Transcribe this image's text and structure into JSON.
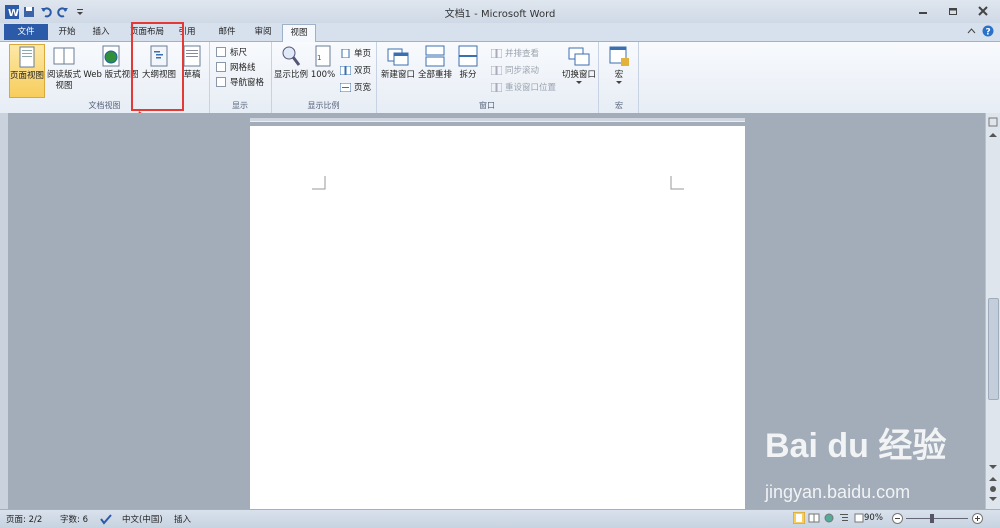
{
  "window": {
    "title": "文档1 - Microsoft Word"
  },
  "tabs": [
    "文件",
    "开始",
    "插入",
    "页面布局",
    "引用",
    "邮件",
    "审阅",
    "视图"
  ],
  "ribbon": {
    "doc_views": {
      "group_label": "文档视图",
      "print_layout": "页面视图",
      "reading_1": "阅读版式",
      "reading_2": "视图",
      "web_layout": "Web 版式视图",
      "outline": "大纲视图",
      "draft": "草稿"
    },
    "show": {
      "group_label": "显示",
      "ruler": "标尺",
      "gridlines": "网格线",
      "nav_pane": "导航窗格"
    },
    "zoom": {
      "group_label": "显示比例",
      "zoom": "显示比例",
      "hundred": "100%",
      "one_page": "单页",
      "two_pages": "双页",
      "page_width": "页宽"
    },
    "window": {
      "group_label": "窗口",
      "new_window": "新建窗口",
      "arrange_all": "全部重排",
      "split": "拆分",
      "side_by_side": "并排查看",
      "sync_scroll": "同步滚动",
      "reset_pos": "重设窗口位置",
      "switch": "切换窗口"
    },
    "macros": {
      "group_label": "宏",
      "macros": "宏"
    }
  },
  "status": {
    "page": "页面: 2/2",
    "words": "字数: 6",
    "lang": "中文(中国)",
    "mode": "插入",
    "zoom": "90%"
  },
  "watermark": {
    "line1": "Bai du 经验",
    "line2": "jingyan.baidu.com"
  },
  "colors": {
    "file_tab": "#2a5aa8",
    "highlight": "#e53935",
    "selected": "#f7cd5c"
  }
}
